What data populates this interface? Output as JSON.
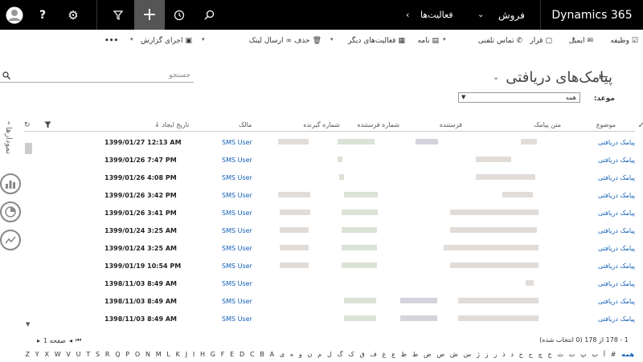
{
  "nav": {
    "brand": "Dynamics 365",
    "area": "فروش",
    "entity": "فعالیت‌ها",
    "icons": [
      "user-avatar-icon",
      "help-icon",
      "gear-icon",
      "filter-icon",
      "plus-icon",
      "history-icon",
      "search-icon"
    ]
  },
  "commands": [
    {
      "label": "وظیفه",
      "icon": "checkbox-icon"
    },
    {
      "label": "ایمیل",
      "icon": "envelope-icon"
    },
    {
      "label": "قرار",
      "icon": "calendar-icon"
    },
    {
      "label": "تماس تلفنی",
      "icon": "phone-icon"
    },
    {
      "label": "نامه",
      "icon": "letter-icon"
    },
    {
      "label": "فعالیت‌های دیگر",
      "icon": "activities-icon"
    },
    {
      "label": "حذف",
      "icon": "trash-icon"
    },
    {
      "label": "ارسال لینک",
      "icon": "link-icon"
    },
    {
      "label": "اجرای گزارش",
      "icon": "report-icon"
    },
    {
      "label": "•••",
      "icon": "more-icon"
    }
  ],
  "search": {
    "placeholder": "جستجو"
  },
  "view": {
    "title": "پیامک‌های دریافتی"
  },
  "filter": {
    "label": "موعد:",
    "value": "همه"
  },
  "columns": {
    "subject": "موضوع",
    "message": "متن پیامک",
    "sender": "فرستنده",
    "sender_number": "شماره فرستنده",
    "receiver_number": "شماره گیرنده",
    "owner": "مالک",
    "created_on": "تاریخ ایجاد ↓"
  },
  "rows": [
    {
      "subject": "پیامک دریافتی",
      "owner": "SMS User",
      "created_on": "1399/01/27 12:13 AM"
    },
    {
      "subject": "پیامک دریافتی",
      "owner": "SMS User",
      "created_on": "1399/01/26 7:47 PM"
    },
    {
      "subject": "پیامک دریافتی",
      "owner": "SMS User",
      "created_on": "1399/01/26 4:08 PM"
    },
    {
      "subject": "پیامک دریافتی",
      "owner": "SMS User",
      "created_on": "1399/01/26 3:42 PM"
    },
    {
      "subject": "پیامک دریافتی",
      "owner": "SMS User",
      "created_on": "1399/01/26 3:41 PM"
    },
    {
      "subject": "پیامک دریافتی",
      "owner": "SMS User",
      "created_on": "1399/01/24 3:25 AM"
    },
    {
      "subject": "پیامک دریافتی",
      "owner": "SMS User",
      "created_on": "1399/01/24 3:25 AM"
    },
    {
      "subject": "پیامک دریافتی",
      "owner": "SMS User",
      "created_on": "1399/01/19 10:54 PM"
    },
    {
      "subject": "پیامک دریافتی",
      "owner": "SMS User",
      "created_on": "1398/11/03 8:49 AM"
    },
    {
      "subject": "پیامک دریافتی",
      "owner": "SMS User",
      "created_on": "1398/11/03 8:49 AM"
    },
    {
      "subject": "پیامک دریافتی",
      "owner": "SMS User",
      "created_on": "1398/11/03 8:49 AM"
    }
  ],
  "side": {
    "charts_label": "نمودارها"
  },
  "footer": {
    "count": "1 - 178 از 178 (0 انتخاب شده)",
    "page": "صفحه 1",
    "alphabet": [
      "همه",
      "#",
      "آ",
      "ب",
      "پ",
      "ت",
      "ث",
      "ج",
      "چ",
      "ح",
      "خ",
      "د",
      "ذ",
      "ر",
      "ز",
      "ژ",
      "س",
      "ش",
      "ص",
      "ض",
      "ط",
      "ظ",
      "ع",
      "غ",
      "ف",
      "ق",
      "ک",
      "گ",
      "ل",
      "م",
      "ن",
      "و",
      "ه",
      "ی",
      "A",
      "B",
      "C",
      "D",
      "E",
      "F",
      "G",
      "H",
      "I",
      "J",
      "K",
      "L",
      "M",
      "N",
      "O",
      "P",
      "Q",
      "R",
      "S",
      "T",
      "U",
      "V",
      "W",
      "X",
      "Y",
      "Z"
    ]
  }
}
